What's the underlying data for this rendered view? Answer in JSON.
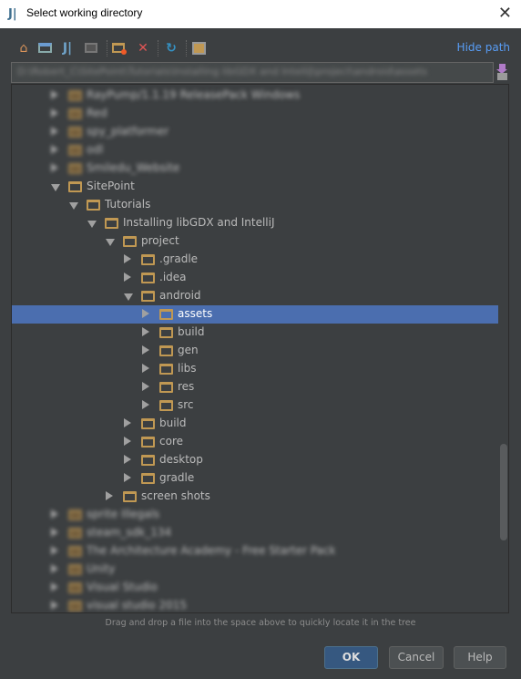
{
  "window": {
    "title": "Select working directory",
    "app_icon": "intellij-icon"
  },
  "toolbar": {
    "icons": [
      "home-icon",
      "desktop-icon",
      "project-icon",
      "module-icon",
      "new-folder-icon",
      "delete-icon",
      "refresh-icon",
      "show-hidden-icon"
    ],
    "hide_path": "Hide path"
  },
  "path": {
    "value": "D:\\Robert_C\\SitePoint\\Tutorials\\Installing libGDX and IntelliJ\\project\\android\\assets"
  },
  "tree": [
    {
      "label": "RayPump/1.1.19 ReleasePack Windows",
      "level": 0,
      "state": "collapsed",
      "blurred": true
    },
    {
      "label": "Red",
      "level": 0,
      "state": "collapsed",
      "blurred": true
    },
    {
      "label": "spy_platformer",
      "level": 0,
      "state": "collapsed",
      "blurred": true
    },
    {
      "label": "odl",
      "level": 0,
      "state": "collapsed",
      "blurred": true
    },
    {
      "label": "Smiledu_Website",
      "level": 0,
      "state": "collapsed",
      "blurred": true
    },
    {
      "label": "SitePoint",
      "level": 0,
      "state": "expanded"
    },
    {
      "label": "Tutorials",
      "level": 1,
      "state": "expanded"
    },
    {
      "label": "Installing libGDX and IntelliJ",
      "level": 2,
      "state": "expanded"
    },
    {
      "label": "project",
      "level": 3,
      "state": "expanded"
    },
    {
      "label": ".gradle",
      "level": 4,
      "state": "collapsed"
    },
    {
      "label": ".idea",
      "level": 4,
      "state": "collapsed"
    },
    {
      "label": "android",
      "level": 4,
      "state": "expanded"
    },
    {
      "label": "assets",
      "level": 5,
      "state": "collapsed",
      "selected": true
    },
    {
      "label": "build",
      "level": 5,
      "state": "collapsed"
    },
    {
      "label": "gen",
      "level": 5,
      "state": "collapsed"
    },
    {
      "label": "libs",
      "level": 5,
      "state": "collapsed"
    },
    {
      "label": "res",
      "level": 5,
      "state": "collapsed"
    },
    {
      "label": "src",
      "level": 5,
      "state": "collapsed"
    },
    {
      "label": "build",
      "level": 4,
      "state": "collapsed"
    },
    {
      "label": "core",
      "level": 4,
      "state": "collapsed"
    },
    {
      "label": "desktop",
      "level": 4,
      "state": "collapsed"
    },
    {
      "label": "gradle",
      "level": 4,
      "state": "collapsed"
    },
    {
      "label": "screen shots",
      "level": 3,
      "state": "collapsed"
    },
    {
      "label": "sprite Illegals",
      "level": 0,
      "state": "collapsed",
      "blurred": true
    },
    {
      "label": "steam_sdk_134",
      "level": 0,
      "state": "collapsed",
      "blurred": true
    },
    {
      "label": "The Architecture Academy - Free Starter Pack",
      "level": 0,
      "state": "collapsed",
      "blurred": true
    },
    {
      "label": "Unity",
      "level": 0,
      "state": "collapsed",
      "blurred": true
    },
    {
      "label": "Visual Studio",
      "level": 0,
      "state": "collapsed",
      "blurred": true
    },
    {
      "label": "visual studio 2015",
      "level": 0,
      "state": "collapsed",
      "blurred": true
    }
  ],
  "hint": "Drag and drop a file into the space above to quickly locate it in the tree",
  "buttons": {
    "ok": "OK",
    "cancel": "Cancel",
    "help": "Help"
  },
  "colors": {
    "selection": "#4b6eaf",
    "link": "#589df6",
    "folder": "#c09853",
    "background": "#3c3f41"
  }
}
